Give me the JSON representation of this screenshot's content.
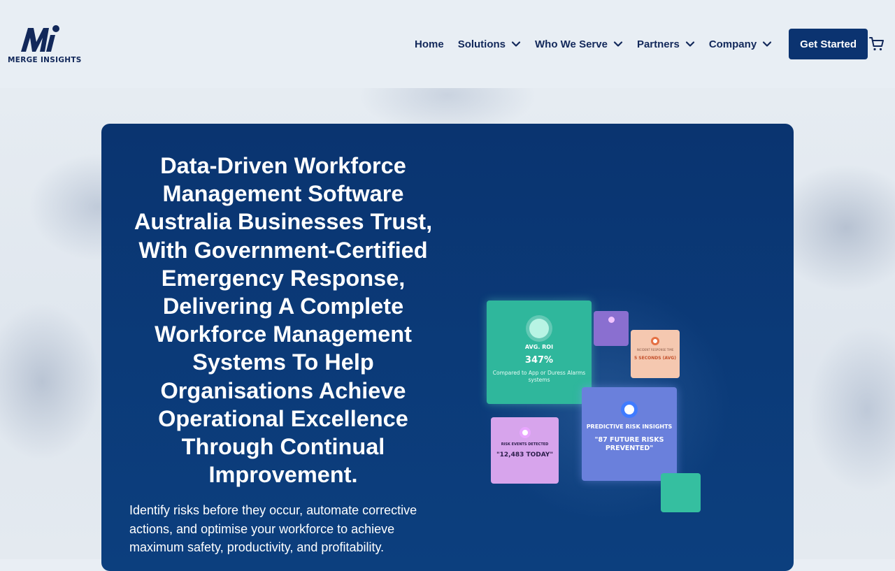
{
  "brand": {
    "logo_letters": "Mi",
    "name": "MERGE INSIGHTS"
  },
  "nav": {
    "items": [
      {
        "label": "Home",
        "has_dropdown": false
      },
      {
        "label": "Solutions",
        "has_dropdown": true
      },
      {
        "label": "Who We Serve",
        "has_dropdown": true
      },
      {
        "label": "Partners",
        "has_dropdown": true
      },
      {
        "label": "Company",
        "has_dropdown": true
      }
    ],
    "cta_label": "Get Started",
    "cart_icon": "cart-icon"
  },
  "hero": {
    "headline": "Data-Driven Workforce Management Software Australia Businesses Trust, With Government-Certified Emergency Response, Delivering A Complete Workforce Management Systems To Help Organisations Achieve Operational Excellence Through Continual Improvement.",
    "subtext": "Identify risks before they occur, automate corrective actions, and optimise your workforce to achieve maximum safety, productivity, and profitability."
  },
  "dashboard": {
    "roi": {
      "label": "AVG. ROI",
      "value": "347%",
      "sub": "Compared to App or Duress Alarms systems"
    },
    "incident": {
      "label": "INCIDENT RESPONSE TIME",
      "value": "5 SECONDS (AVG)"
    },
    "risk_events": {
      "label": "RISK EVENTS DETECTED",
      "value": "\"12,483 TODAY\""
    },
    "predictive": {
      "label": "PREDICTIVE RISK INSIGHTS",
      "value": "\"87 FUTURE RISKS PREVENTED\""
    }
  },
  "colors": {
    "brand_navy": "#12285a",
    "cta_bg": "#0b3370",
    "card_bg": "#0a3470",
    "roi_tile": "#2fb79c",
    "predict_tile": "#6a80dc",
    "risk_tile": "#d7a4ec",
    "incident_tile": "#f5c8b0"
  }
}
